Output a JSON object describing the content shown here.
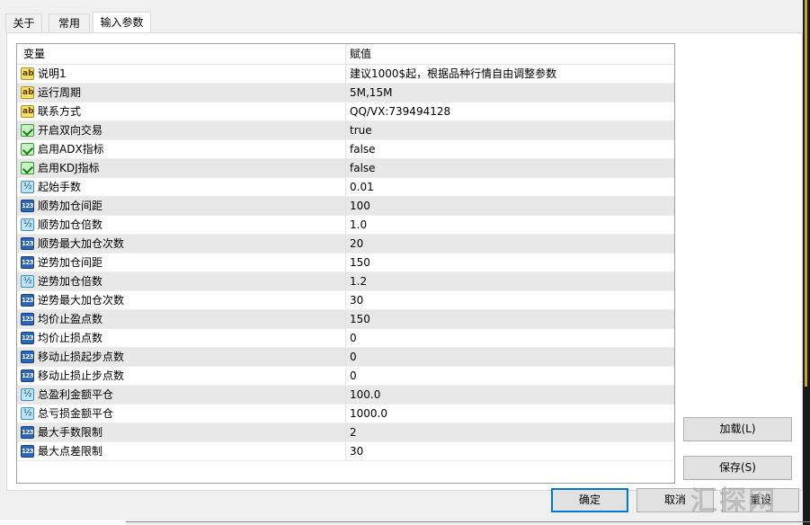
{
  "tabs": [
    {
      "label": "关于"
    },
    {
      "label": "常用"
    },
    {
      "label": "输入参数"
    }
  ],
  "grid": {
    "headers": {
      "name": "变量",
      "value": "赋值"
    },
    "rows": [
      {
        "icon": "ab",
        "name": "说明1",
        "value": "建议1000$起，根据品种行情自由调整参数"
      },
      {
        "icon": "ab",
        "name": "运行周期",
        "value": "5M,15M"
      },
      {
        "icon": "ab",
        "name": "联系方式",
        "value": "QQ/VX:739494128"
      },
      {
        "icon": "bool",
        "name": "开启双向交易",
        "value": "true"
      },
      {
        "icon": "bool",
        "name": "启用ADX指标",
        "value": "false"
      },
      {
        "icon": "bool",
        "name": "启用KDJ指标",
        "value": "false"
      },
      {
        "icon": "dbl",
        "name": "起始手数",
        "value": "0.01"
      },
      {
        "icon": "int",
        "name": "顺势加仓间距",
        "value": "100"
      },
      {
        "icon": "dbl",
        "name": "顺势加仓倍数",
        "value": "1.0"
      },
      {
        "icon": "int",
        "name": "顺势最大加仓次数",
        "value": "20"
      },
      {
        "icon": "int",
        "name": "逆势加仓间距",
        "value": "150"
      },
      {
        "icon": "dbl",
        "name": "逆势加仓倍数",
        "value": "1.2"
      },
      {
        "icon": "int",
        "name": "逆势最大加仓次数",
        "value": "30"
      },
      {
        "icon": "int",
        "name": "均价止盈点数",
        "value": "150"
      },
      {
        "icon": "int",
        "name": "均价止损点数",
        "value": "0"
      },
      {
        "icon": "int",
        "name": "移动止损起步点数",
        "value": "0"
      },
      {
        "icon": "int",
        "name": "移动止损止步点数",
        "value": "0"
      },
      {
        "icon": "dbl",
        "name": "总盈利金额平仓",
        "value": "100.0"
      },
      {
        "icon": "dbl",
        "name": "总亏损金额平仓",
        "value": "1000.0"
      },
      {
        "icon": "int",
        "name": "最大手数限制",
        "value": "2"
      },
      {
        "icon": "int",
        "name": "最大点差限制",
        "value": "30"
      }
    ]
  },
  "buttons": {
    "load": "加载(L)",
    "save": "保存(S)",
    "ok": "确定",
    "cancel": "取消",
    "reset": "重设"
  },
  "watermark": "汇探网",
  "icon_names": {
    "ab": "string-type-icon",
    "bool": "bool-type-icon",
    "dbl": "double-type-icon",
    "int": "integer-type-icon"
  }
}
